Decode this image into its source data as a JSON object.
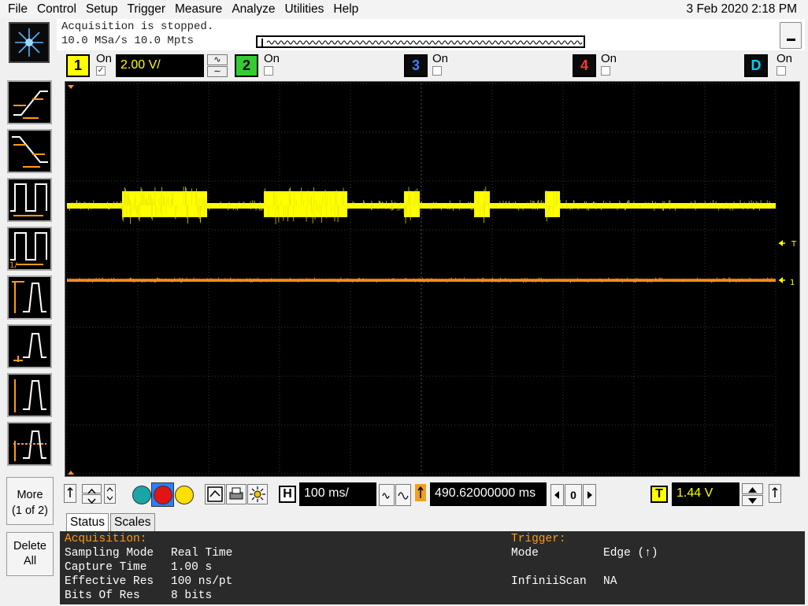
{
  "menu": {
    "items": [
      "File",
      "Control",
      "Setup",
      "Trigger",
      "Measure",
      "Analyze",
      "Utilities",
      "Help"
    ],
    "datetime": "3 Feb 2020  2:18 PM"
  },
  "acquisition": {
    "status": "Acquisition is stopped.",
    "rate": "10.0 MSa/s   10.0 Mpts"
  },
  "channels": {
    "ch1": {
      "label": "1",
      "on_label": "On",
      "checked": true,
      "scale": "2.00 V/",
      "color": "#ffff00"
    },
    "ch2": {
      "label": "2",
      "on_label": "On",
      "checked": false,
      "color": "#33cc33"
    },
    "ch3": {
      "label": "3",
      "on_label": "On",
      "checked": false,
      "color": "#3366ff"
    },
    "ch4": {
      "label": "4",
      "on_label": "On",
      "checked": false,
      "color": "#ff3333"
    },
    "digital": {
      "label": "D",
      "on_label": "On",
      "checked": false,
      "color": "#00ccff"
    }
  },
  "palette": {
    "more_label": "More",
    "more_page": "(1 of 2)",
    "delete_label": "Delete",
    "delete_label2": "All"
  },
  "screen": {
    "trigger_marker": "T",
    "ch1_marker": "1",
    "ch1_trace_color": "#ffff00",
    "ref_trace_color": "#ff8c1a"
  },
  "horizontal": {
    "h_label": "H",
    "timebase": "100 ms/",
    "position": "490.62000000 ms",
    "delay_value": "0"
  },
  "trigger": {
    "t_label": "T",
    "level": "1.44 V"
  },
  "tabs": {
    "status": "Status",
    "scales": "Scales"
  },
  "status": {
    "acq_head": "Acquisition:",
    "rows": [
      {
        "label": "Sampling Mode",
        "value": "Real Time"
      },
      {
        "label": "Capture Time",
        "value": "1.00 s"
      },
      {
        "label": "Effective Res",
        "value": "100 ns/pt"
      },
      {
        "label": "Bits Of Res",
        "value": "8 bits"
      }
    ],
    "trig_head": "Trigger:",
    "trig_rows": [
      {
        "label": "Mode",
        "value": "Edge (↑)"
      },
      {
        "label": "InfiniiScan",
        "value": "NA"
      }
    ]
  }
}
